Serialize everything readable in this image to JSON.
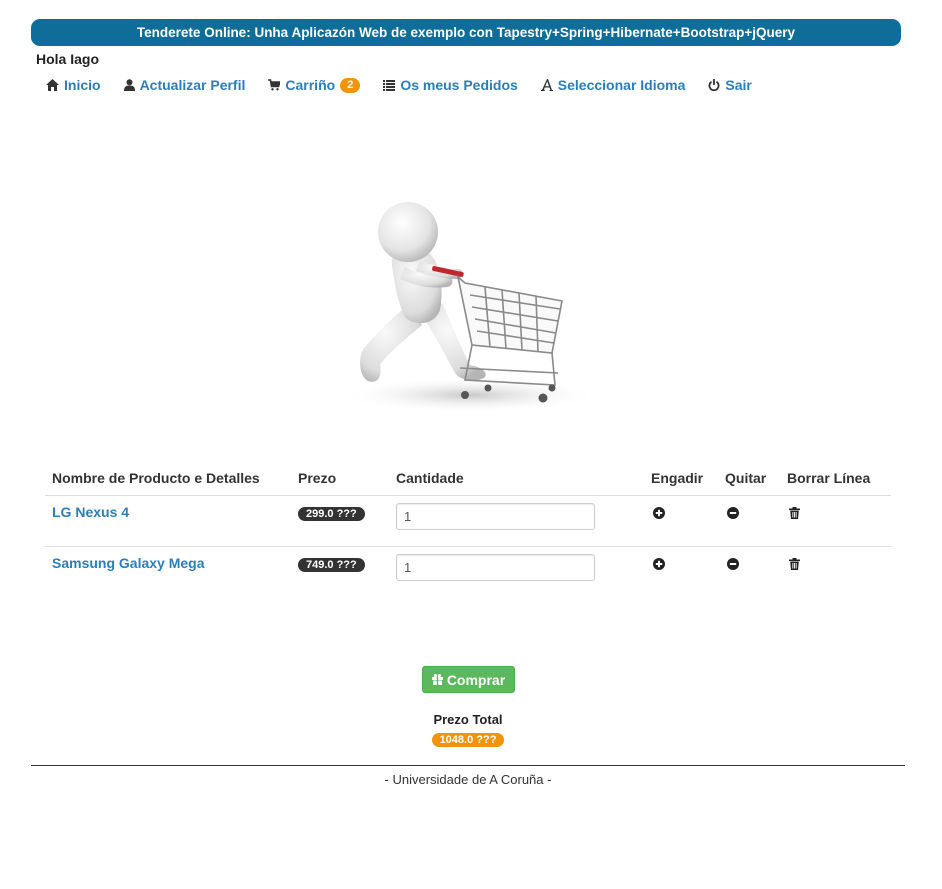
{
  "header": {
    "banner_title": "Tenderete Online: Unha Aplicazón Web de exemplo con Tapestry+Spring+Hibernate+Bootstrap+jQuery",
    "greeting": "Hola Iago"
  },
  "nav": {
    "home": {
      "label": "Inicio",
      "icon": "home-icon"
    },
    "profile": {
      "label": "Actualizar Perfil",
      "icon": "user-icon"
    },
    "cart": {
      "label": "Carriño",
      "icon": "cart-icon",
      "count": "2"
    },
    "orders": {
      "label": "Os meus Pedidos",
      "icon": "list-icon"
    },
    "language": {
      "label": "Seleccionar Idioma",
      "icon": "font-icon"
    },
    "logout": {
      "label": "Sair",
      "icon": "power-icon"
    }
  },
  "cart_table": {
    "headers": {
      "product": "Nombre de Producto e Detalles",
      "price": "Prezo",
      "quantity": "Cantidade",
      "add": "Engadir",
      "remove": "Quitar",
      "delete": "Borrar Línea"
    },
    "rows": [
      {
        "name": "LG Nexus 4",
        "price": "299.0 ???",
        "quantity": "1"
      },
      {
        "name": "Samsung Galaxy Mega",
        "price": "749.0 ???",
        "quantity": "1"
      }
    ]
  },
  "checkout": {
    "buy_label": "Comprar",
    "total_label": "Prezo Total",
    "total_value": "1048.0 ???"
  },
  "footer": {
    "text": "- Universidade de A Coruña -"
  },
  "colors": {
    "banner": "#0f6d9a",
    "link": "#2a7fba",
    "badge_orange": "#f0940a",
    "badge_dark": "#333333",
    "buy_green": "#5cb85c"
  }
}
